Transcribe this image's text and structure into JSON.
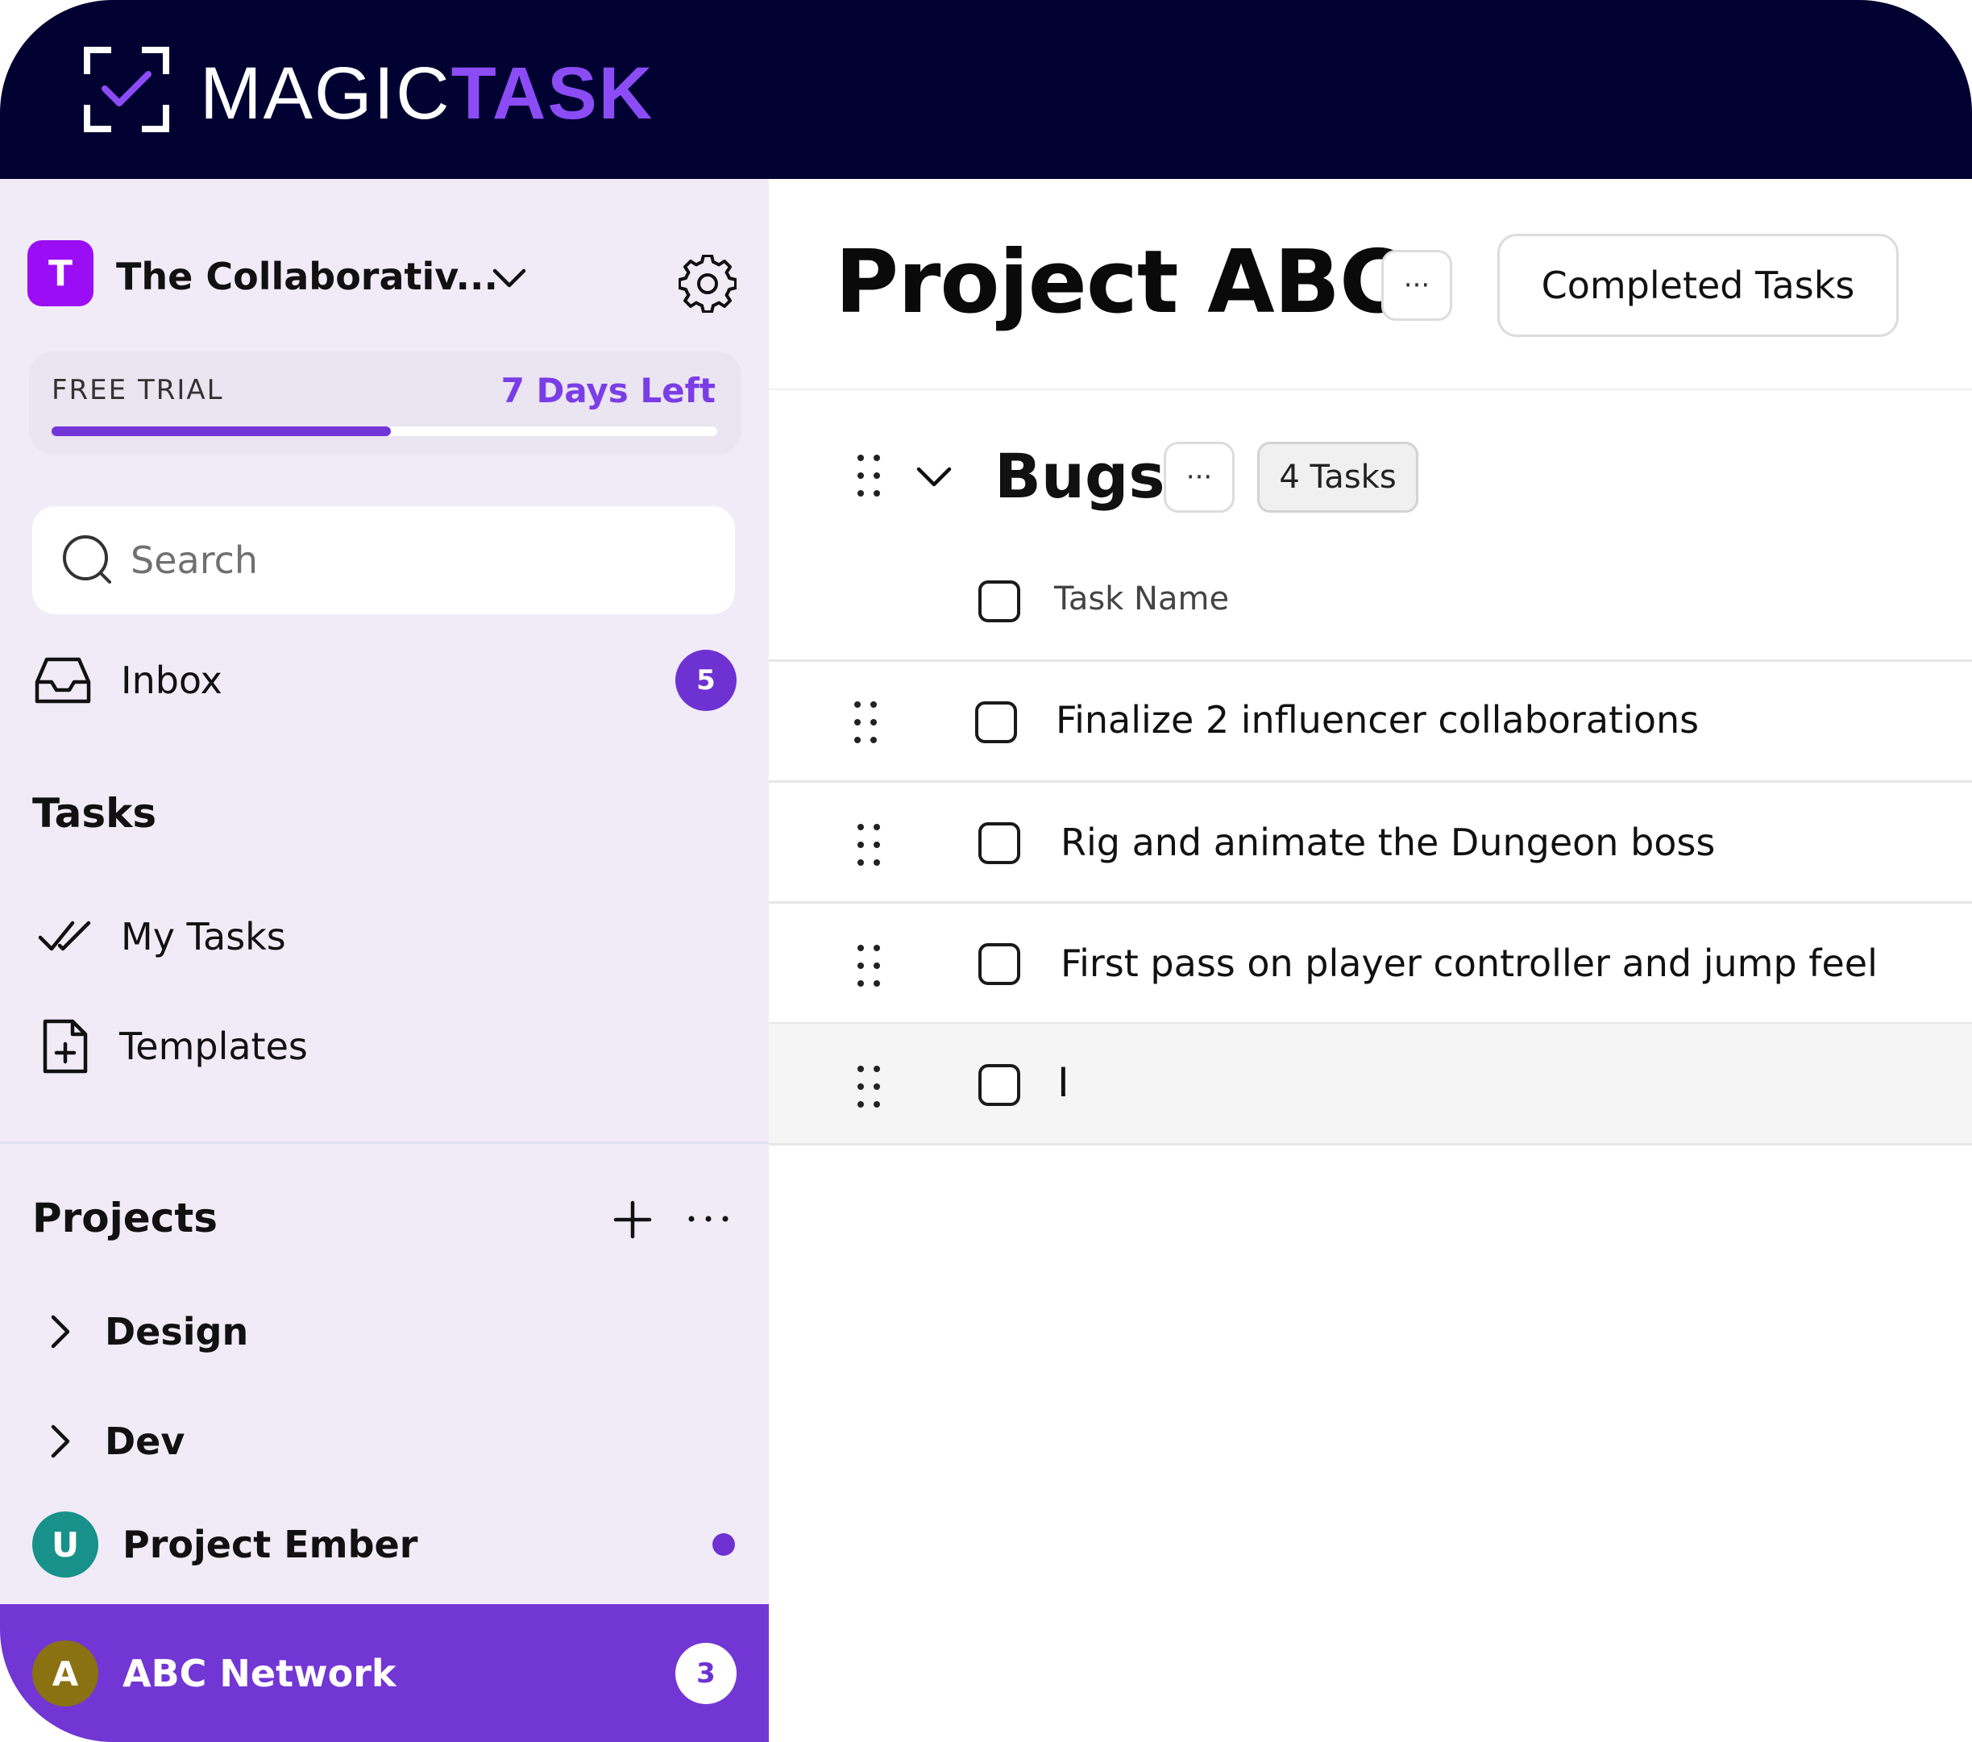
{
  "brand": {
    "name_part1": "MAGIC",
    "name_part2": "TASK",
    "accent_color": "#8c4cf5",
    "topbar_color": "#010232"
  },
  "sidebar": {
    "workspace": {
      "avatar_letter": "T",
      "name": "The Collaborativ..."
    },
    "trial": {
      "label": "FREE TRIAL",
      "days_left": "7 Days Left",
      "progress_fraction": 0.51
    },
    "search": {
      "placeholder": "Search"
    },
    "inbox": {
      "label": "Inbox",
      "count": "5"
    },
    "tasks_section": {
      "title": "Tasks",
      "items": [
        {
          "label": "My Tasks",
          "icon": "double-check-icon"
        },
        {
          "label": "Templates",
          "icon": "file-plus-icon"
        }
      ]
    },
    "projects_section": {
      "title": "Projects",
      "folders": [
        {
          "label": "Design"
        },
        {
          "label": "Dev"
        }
      ],
      "projects": [
        {
          "avatar_letter": "U",
          "name": "Project Ember",
          "avatar_color": "#17918a",
          "unread_dot": true
        },
        {
          "avatar_letter": "A",
          "name": "ABC Network",
          "avatar_color": "#8a7213",
          "count": "3",
          "active": true
        }
      ]
    }
  },
  "main": {
    "title": "Project ABC",
    "more_label": "···",
    "completed_tasks_label": "Completed Tasks",
    "group": {
      "title": "Bugs",
      "more_label": "···",
      "count_label": "4 Tasks",
      "column_header": "Task Name",
      "tasks": [
        {
          "name": "Finalize 2 influencer collaborations"
        },
        {
          "name": "Rig and animate the Dungeon boss"
        },
        {
          "name": "First pass on player controller and jump feel"
        }
      ],
      "new_task_value": "I"
    }
  }
}
